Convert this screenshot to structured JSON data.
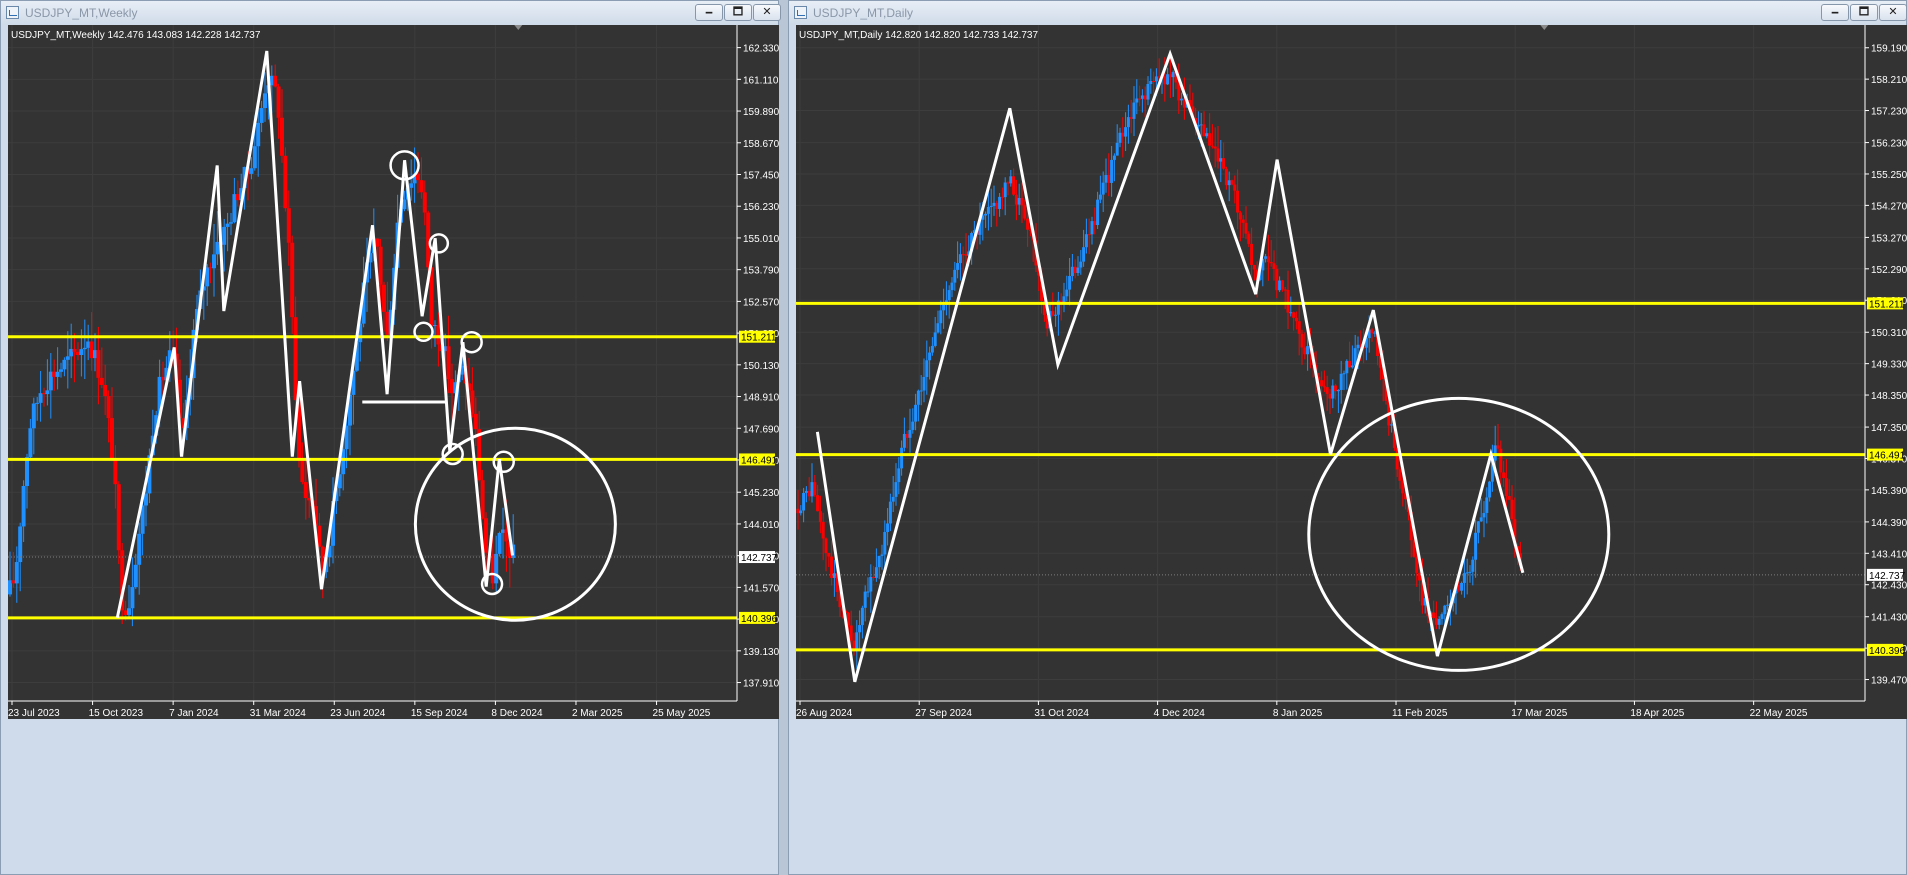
{
  "windows": [
    {
      "title": "USDJPY_MT,Weekly",
      "ohlc_label": "USDJPY_MT,Weekly  142.476 143.083 142.228 142.737",
      "buttons": {
        "minimize": "🗕",
        "maximize": "🗖",
        "close": "✕"
      },
      "chart_data": {
        "type": "line",
        "symbol": "USDJPY_MT",
        "timeframe": "Weekly",
        "ohlc": {
          "open": 142.476,
          "high": 143.083,
          "low": 142.228,
          "close": 142.737
        },
        "price_ticks": [
          "162.330",
          "161.110",
          "159.890",
          "158.670",
          "157.450",
          "156.230",
          "155.010",
          "153.790",
          "152.570",
          "151.350",
          "150.130",
          "148.910",
          "147.690",
          "146.470",
          "145.230",
          "144.010",
          "142.790",
          "141.570",
          "140.350",
          "139.130",
          "137.910"
        ],
        "yrange": [
          137.2,
          163.2
        ],
        "date_labels": [
          "23 Jul 2023",
          "15 Oct 2023",
          "7 Jan 2024",
          "31 Mar 2024",
          "23 Jun 2024",
          "15 Sep 2024",
          "8 Dec 2024",
          "2 Mar 2025",
          "25 May 2025"
        ],
        "current_price": "142.737",
        "horizontal_levels": [
          {
            "price": 151.211,
            "label": "151.211"
          },
          {
            "price": 146.491,
            "label": "146.491"
          },
          {
            "price": 140.396,
            "label": "140.396"
          }
        ],
        "zigzag": [
          [
            0.15,
            140.4
          ],
          [
            0.228,
            150.8
          ],
          [
            0.238,
            146.6
          ],
          [
            0.287,
            157.8
          ],
          [
            0.296,
            152.2
          ],
          [
            0.355,
            162.2
          ],
          [
            0.39,
            146.6
          ],
          [
            0.4,
            149.5
          ],
          [
            0.43,
            141.5
          ],
          [
            0.5,
            155.5
          ],
          [
            0.52,
            149.0
          ],
          [
            0.544,
            158.0
          ],
          [
            0.568,
            152.0
          ],
          [
            0.586,
            155.0
          ],
          [
            0.606,
            146.8
          ],
          [
            0.624,
            151.0
          ],
          [
            0.656,
            141.6
          ],
          [
            0.674,
            146.5
          ],
          [
            0.692,
            142.8
          ]
        ],
        "neckline": {
          "x0": 0.486,
          "x1": 0.602,
          "price": 148.7
        },
        "circles": [
          {
            "x": 0.544,
            "price": 157.8,
            "r": 14
          },
          {
            "x": 0.591,
            "price": 154.8,
            "r": 9
          },
          {
            "x": 0.57,
            "price": 151.4,
            "r": 9
          },
          {
            "x": 0.636,
            "price": 151.0,
            "r": 10
          },
          {
            "x": 0.61,
            "price": 146.7,
            "r": 10
          },
          {
            "x": 0.68,
            "price": 146.4,
            "r": 10
          },
          {
            "x": 0.664,
            "price": 141.7,
            "r": 10
          }
        ],
        "ellipse": {
          "x": 0.696,
          "price": 144.0,
          "rx": 100,
          "ry": 96
        },
        "candle_path": [
          [
            0.0,
            141.3
          ],
          [
            0.01,
            142.0
          ],
          [
            0.02,
            145.2
          ],
          [
            0.03,
            147.8
          ],
          [
            0.045,
            149.2
          ],
          [
            0.06,
            149.8
          ],
          [
            0.08,
            150.2
          ],
          [
            0.09,
            150.5
          ],
          [
            0.11,
            151.2
          ],
          [
            0.13,
            149.5
          ],
          [
            0.145,
            146.3
          ],
          [
            0.155,
            141.2
          ],
          [
            0.165,
            140.8
          ],
          [
            0.175,
            142.8
          ],
          [
            0.19,
            145.5
          ],
          [
            0.2,
            148.2
          ],
          [
            0.21,
            149.5
          ],
          [
            0.225,
            150.6
          ],
          [
            0.24,
            147.2
          ],
          [
            0.255,
            151.5
          ],
          [
            0.27,
            153.5
          ],
          [
            0.285,
            154.8
          ],
          [
            0.3,
            155.4
          ],
          [
            0.315,
            156.8
          ],
          [
            0.33,
            157.6
          ],
          [
            0.345,
            159.5
          ],
          [
            0.355,
            161.3
          ],
          [
            0.37,
            160.4
          ],
          [
            0.385,
            154.6
          ],
          [
            0.4,
            146.0
          ],
          [
            0.41,
            145.0
          ],
          [
            0.42,
            144.8
          ],
          [
            0.43,
            142.0
          ],
          [
            0.44,
            143.4
          ],
          [
            0.46,
            147.2
          ],
          [
            0.475,
            150.2
          ],
          [
            0.49,
            153.4
          ],
          [
            0.505,
            155.0
          ],
          [
            0.52,
            151.0
          ],
          [
            0.535,
            155.8
          ],
          [
            0.545,
            157.0
          ],
          [
            0.56,
            157.6
          ],
          [
            0.57,
            156.8
          ],
          [
            0.58,
            151.8
          ],
          [
            0.595,
            151.1
          ],
          [
            0.61,
            149.0
          ],
          [
            0.625,
            150.0
          ],
          [
            0.64,
            148.0
          ],
          [
            0.655,
            143.0
          ],
          [
            0.665,
            142.0
          ],
          [
            0.675,
            143.5
          ],
          [
            0.685,
            143.2
          ],
          [
            0.695,
            142.7
          ]
        ]
      }
    },
    {
      "title": "USDJPY_MT,Daily",
      "ohlc_label": "USDJPY_MT,Daily  142.820 142.820 142.733 142.737",
      "buttons": {
        "minimize": "🗕",
        "maximize": "🗖",
        "close": "✕"
      },
      "chart_data": {
        "type": "line",
        "symbol": "USDJPY_MT",
        "timeframe": "Daily",
        "ohlc": {
          "open": 142.82,
          "high": 142.82,
          "low": 142.733,
          "close": 142.737
        },
        "price_ticks": [
          "159.190",
          "158.210",
          "157.230",
          "156.230",
          "155.250",
          "154.270",
          "153.270",
          "152.290",
          "151.310",
          "150.310",
          "149.330",
          "148.350",
          "147.350",
          "146.370",
          "145.390",
          "144.390",
          "143.410",
          "142.430",
          "141.430",
          "140.450",
          "139.470"
        ],
        "yrange": [
          138.8,
          159.9
        ],
        "date_labels": [
          "26 Aug 2024",
          "27 Sep 2024",
          "31 Oct 2024",
          "4 Dec 2024",
          "8 Jan 2025",
          "11 Feb 2025",
          "17 Mar 2025",
          "18 Apr 2025",
          "22 May 2025"
        ],
        "current_price": "142.737",
        "horizontal_levels": [
          {
            "price": 151.211,
            "label": "151.211"
          },
          {
            "price": 146.491,
            "label": "146.491"
          },
          {
            "price": 140.396,
            "label": "140.396"
          }
        ],
        "zigzag": [
          [
            0.02,
            147.2
          ],
          [
            0.055,
            139.4
          ],
          [
            0.2,
            157.3
          ],
          [
            0.245,
            149.3
          ],
          [
            0.35,
            159.0
          ],
          [
            0.43,
            151.5
          ],
          [
            0.45,
            155.7
          ],
          [
            0.5,
            146.5
          ],
          [
            0.54,
            151.0
          ],
          [
            0.6,
            140.2
          ],
          [
            0.65,
            146.5
          ],
          [
            0.68,
            142.8
          ]
        ],
        "ellipse": {
          "x": 0.62,
          "price": 144.0,
          "rx": 150,
          "ry": 136
        },
        "candle_path": [
          [
            0.0,
            144.8
          ],
          [
            0.015,
            145.5
          ],
          [
            0.03,
            143.2
          ],
          [
            0.045,
            141.5
          ],
          [
            0.055,
            140.5
          ],
          [
            0.065,
            142.0
          ],
          [
            0.08,
            143.5
          ],
          [
            0.1,
            146.8
          ],
          [
            0.12,
            149.0
          ],
          [
            0.14,
            151.5
          ],
          [
            0.16,
            153.0
          ],
          [
            0.18,
            154.0
          ],
          [
            0.2,
            155.0
          ],
          [
            0.22,
            153.5
          ],
          [
            0.235,
            150.5
          ],
          [
            0.25,
            151.5
          ],
          [
            0.27,
            153.0
          ],
          [
            0.29,
            155.0
          ],
          [
            0.31,
            157.0
          ],
          [
            0.33,
            158.0
          ],
          [
            0.35,
            158.4
          ],
          [
            0.37,
            157.0
          ],
          [
            0.39,
            156.0
          ],
          [
            0.41,
            154.5
          ],
          [
            0.43,
            152.0
          ],
          [
            0.44,
            152.5
          ],
          [
            0.46,
            151.2
          ],
          [
            0.48,
            149.5
          ],
          [
            0.5,
            148.4
          ],
          [
            0.52,
            149.5
          ],
          [
            0.54,
            150.3
          ],
          [
            0.555,
            147.5
          ],
          [
            0.57,
            145.0
          ],
          [
            0.585,
            142.0
          ],
          [
            0.6,
            141.2
          ],
          [
            0.615,
            142.0
          ],
          [
            0.63,
            143.0
          ],
          [
            0.645,
            145.0
          ],
          [
            0.655,
            147.0
          ],
          [
            0.665,
            145.2
          ],
          [
            0.675,
            143.3
          ],
          [
            0.68,
            142.7
          ]
        ]
      }
    }
  ]
}
